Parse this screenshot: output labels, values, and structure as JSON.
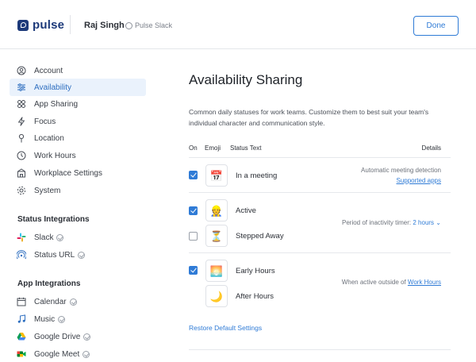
{
  "header": {
    "brand": "pulse",
    "user_name": "Raj Singh",
    "workspace": "Pulse Slack",
    "done_label": "Done"
  },
  "sidebar": {
    "items": [
      {
        "label": "Account",
        "icon": "user-circle-icon"
      },
      {
        "label": "Availability",
        "icon": "sliders-icon",
        "active": true
      },
      {
        "label": "App Sharing",
        "icon": "apps-icon"
      },
      {
        "label": "Focus",
        "icon": "lightning-icon"
      },
      {
        "label": "Location",
        "icon": "pin-icon"
      },
      {
        "label": "Work Hours",
        "icon": "clock-icon"
      },
      {
        "label": "Workplace Settings",
        "icon": "building-icon"
      },
      {
        "label": "System",
        "icon": "gear-icon"
      }
    ],
    "status_integrations_title": "Status Integrations",
    "status_integrations": [
      {
        "label": "Slack",
        "icon": "slack-icon"
      },
      {
        "label": "Status URL",
        "icon": "broadcast-icon"
      }
    ],
    "app_integrations_title": "App Integrations",
    "app_integrations": [
      {
        "label": "Calendar",
        "icon": "calendar-icon"
      },
      {
        "label": "Music",
        "icon": "music-icon"
      },
      {
        "label": "Google Drive",
        "icon": "google-drive-icon"
      },
      {
        "label": "Google Meet",
        "icon": "google-meet-icon"
      }
    ]
  },
  "main": {
    "title": "Availability Sharing",
    "description": "Common daily statuses for work teams. Customize them to best suit your team's individual character and communication style.",
    "columns": {
      "on": "On",
      "emoji": "Emoji",
      "status": "Status Text",
      "details": "Details"
    },
    "rows": [
      {
        "checked": true,
        "emoji": "📅",
        "status": "In a meeting"
      },
      {
        "checked": true,
        "emoji": "👷",
        "status": "Active"
      },
      {
        "checked": false,
        "emoji": "⏳",
        "status": "Stepped Away"
      },
      {
        "checked": true,
        "emoji": "🌅",
        "status": "Early Hours"
      },
      {
        "checked": null,
        "emoji": "🌙",
        "status": "After Hours"
      }
    ],
    "details": {
      "meeting_detection": "Automatic meeting detection",
      "supported_apps": "Supported apps",
      "inactivity_prefix": "Period of inactivity timer:",
      "inactivity_value": "2 hours",
      "when_active_prefix": "When active outside of",
      "work_hours_link": "Work Hours"
    },
    "restore_label": "Restore Default Settings"
  },
  "colors": {
    "accent": "#2f7bd6",
    "brand": "#1d3a7a",
    "active_bg": "#eaf2fc"
  }
}
